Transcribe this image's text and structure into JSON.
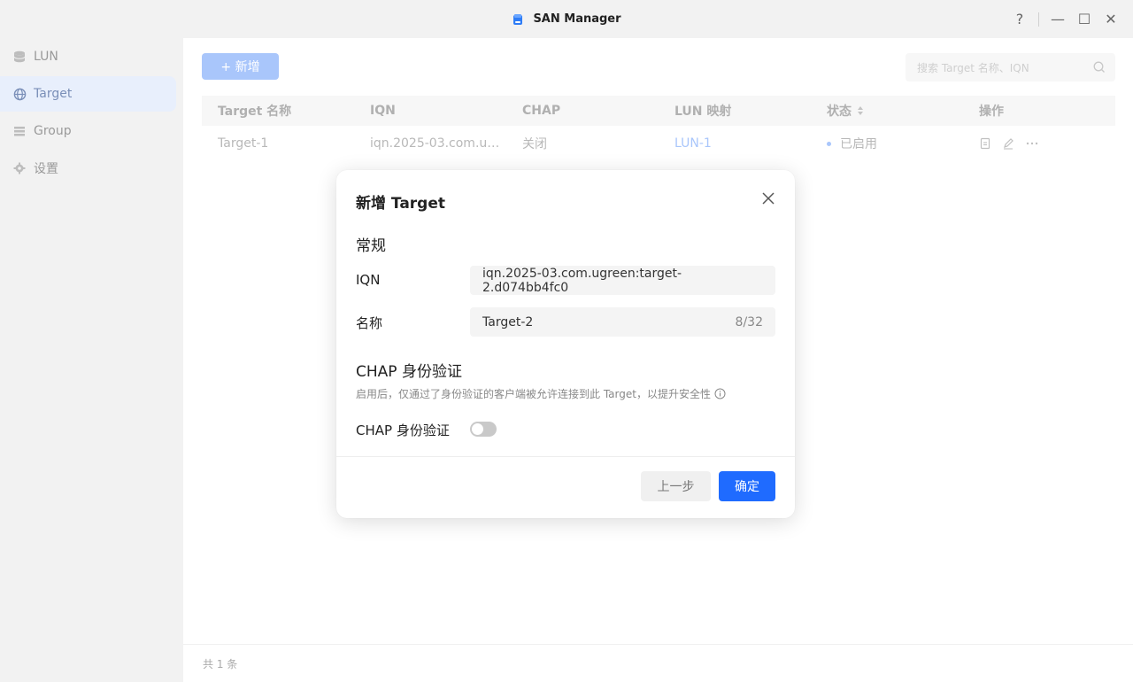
{
  "window": {
    "title": "SAN Manager",
    "controls": [
      "?",
      "—",
      "☐",
      "✕"
    ]
  },
  "sidebar": {
    "items": [
      {
        "label": "LUN",
        "icon": "database-icon",
        "active": false
      },
      {
        "label": "Target",
        "icon": "globe-icon",
        "active": true
      },
      {
        "label": "Group",
        "icon": "list-icon",
        "active": false
      },
      {
        "label": "设置",
        "icon": "gear-icon",
        "active": false
      }
    ]
  },
  "toolbar": {
    "add_label": "+ 新增",
    "search_placeholder": "搜索 Target 名称、IQN"
  },
  "table": {
    "columns": [
      "Target 名称",
      "IQN",
      "CHAP",
      "LUN 映射",
      "状态",
      "操作"
    ],
    "rows": [
      {
        "name": "Target-1",
        "iqn": "iqn.2025-03.com.ugreen:target-1…",
        "chap": "关闭",
        "lun": "LUN-1",
        "status": "已启用"
      }
    ]
  },
  "footer": {
    "total": "共 1 条"
  },
  "modal": {
    "title": "新增 Target",
    "section_general": "常规",
    "iqn_label": "IQN",
    "iqn_value": "iqn.2025-03.com.ugreen:target-2.d074bb4fc0",
    "name_label": "名称",
    "name_value": "Target-2",
    "name_counter": "8/32",
    "section_chap": "CHAP 身份验证",
    "chap_hint": "启用后，仅通过了身份验证的客户端被允许连接到此 Target，以提升安全性",
    "chap_toggle_label": "CHAP 身份验证",
    "chap_enabled": false,
    "prev_label": "上一步",
    "ok_label": "确定"
  },
  "colors": {
    "accent": "#1f6bff",
    "accent_light": "#a9c6fb",
    "sidebar_bg": "#f2f2f2"
  }
}
